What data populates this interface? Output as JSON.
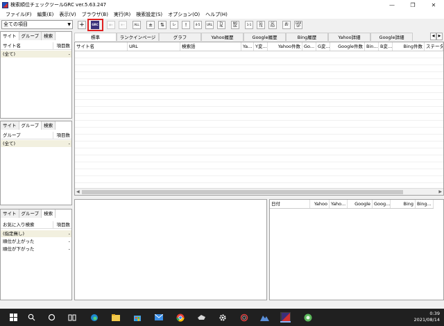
{
  "window": {
    "title": "検索順位チェックツールGRC  ver.5.63.247",
    "controls": [
      "—",
      "❐",
      "✕"
    ]
  },
  "menu": [
    "ファイル(F)",
    "編集(E)",
    "表示(V)",
    "ブラウザ(B)",
    "実行(R)",
    "検索設定(S)",
    "オプション(O)",
    "ヘルプ(H)"
  ],
  "toolbar": {
    "filter_value": "全ての項目",
    "buttons": [
      "+",
      "GRC",
      "⇤",
      "⇠",
      "ALL",
      "±",
      "⇅",
      "レ",
      "!",
      "4-5",
      "URL",
      "TY PE",
      "MO DE",
      "1-1",
      "S1 T6",
      "SC RO",
      "お",
      "GRP UP"
    ]
  },
  "sites_panel": {
    "tabs": [
      "サイト",
      "グループ",
      "検索"
    ],
    "headers": [
      "サイト名",
      "項目数"
    ],
    "rows": [
      {
        "name": "(全て)",
        "count": "-"
      }
    ]
  },
  "groups_panel": {
    "tabs": [
      "サイト",
      "グループ",
      "検索"
    ],
    "headers": [
      "グループ",
      "項目数"
    ],
    "rows": [
      {
        "name": "(全て)",
        "count": "-"
      }
    ]
  },
  "search_panel": {
    "tabs": [
      "サイト",
      "グループ",
      "検索"
    ],
    "headers": [
      "お気に入り検索",
      "項目数"
    ],
    "rows": [
      {
        "name": "(指定無し)",
        "count": "-"
      },
      {
        "name": "順位が上がった",
        "count": "-"
      },
      {
        "name": "順位が下がった",
        "count": "-"
      }
    ]
  },
  "main_tabs": [
    "標準",
    "ランクインページ",
    "グラフ",
    "Yahoo履歴",
    "Google履歴",
    "Bing履歴",
    "Yahoo詳細",
    "Google詳細"
  ],
  "main_grid": {
    "columns": [
      "サイト名",
      "URL",
      "検索語",
      "Ya...",
      "Y変...",
      "Yahoo件数",
      "Go...",
      "G変...",
      "Google件数",
      "Bin...",
      "B変...",
      "Bing件数",
      "ステータス"
    ]
  },
  "history_grid": {
    "columns": [
      "日付",
      "Yahoo",
      "Yaho...",
      "Google",
      "Goog...",
      "Bing",
      "Bing..."
    ]
  },
  "taskbar": {
    "time": "0:39",
    "date": "2021/08/14"
  }
}
